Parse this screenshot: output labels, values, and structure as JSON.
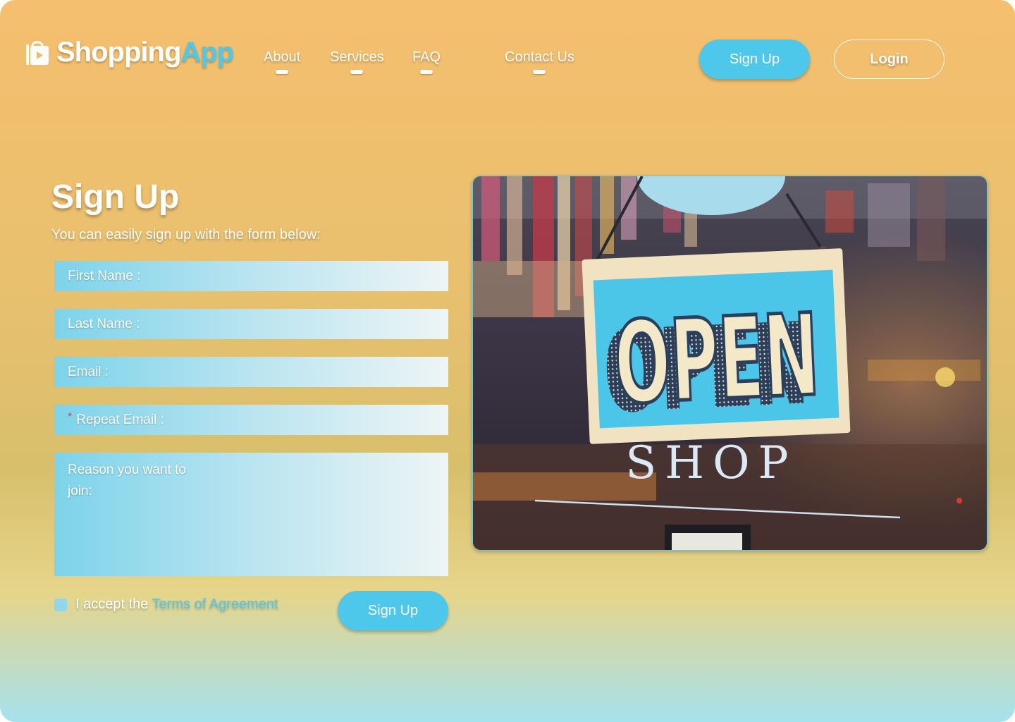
{
  "header": {
    "logo": {
      "part1": "Shopping",
      "part2": "App"
    },
    "nav": [
      {
        "label": "About"
      },
      {
        "label": "Services"
      },
      {
        "label": "FAQ"
      },
      {
        "label": "Contact Us"
      }
    ],
    "signup_label": "Sign Up",
    "login_label": "Login"
  },
  "form": {
    "title": "Sign Up",
    "subtitle": "You can easily sign up with the form below:",
    "fields": {
      "first_name": "First Name :",
      "last_name": "Last Name :",
      "email": "Email :",
      "repeat_email_required": "*",
      "repeat_email": "Repeat Email :",
      "reason": "Reason you want to join:"
    },
    "accept_prefix": "I accept the",
    "terms_label": "Terms of Agreement",
    "submit_label": "Sign Up"
  },
  "photo": {
    "sign_word": "OPEN",
    "shop_word": "SHOP"
  },
  "colors": {
    "accent": "#4dc7ea",
    "background_top": "#f5bf6f",
    "background_bottom": "#a5e2ec",
    "required": "#e23c3c"
  },
  "icons": {
    "logo": "shopping-bag-icon"
  }
}
